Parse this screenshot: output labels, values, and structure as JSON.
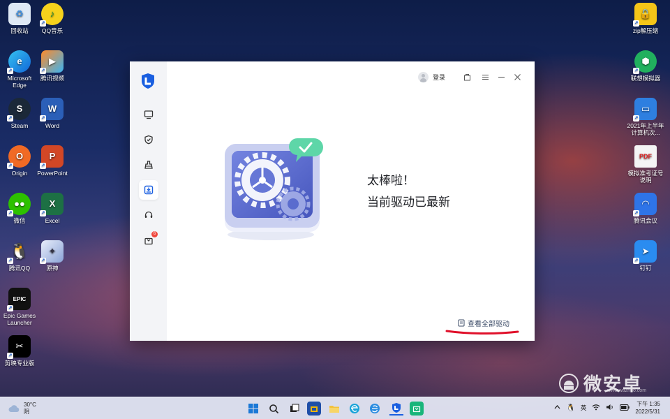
{
  "desktop_left": [
    {
      "label": "回收站",
      "icon": "recycle-bin-icon",
      "color": "#5aa7e8"
    },
    {
      "label": "QQ音乐",
      "icon": "qq-music-icon",
      "color": "#f6d21c"
    },
    {
      "label": "Microsoft Edge",
      "icon": "edge-icon",
      "color": "#1aa3d8"
    },
    {
      "label": "腾讯视频",
      "icon": "tencent-video-icon",
      "color": "#3bb4f2"
    },
    {
      "label": "Steam",
      "icon": "steam-icon",
      "color": "#1b2838"
    },
    {
      "label": "Word",
      "icon": "word-icon",
      "color": "#2b5fb8"
    },
    {
      "label": "Origin",
      "icon": "origin-icon",
      "color": "#f06a25"
    },
    {
      "label": "PowerPoint",
      "icon": "powerpoint-icon",
      "color": "#d24726"
    },
    {
      "label": "微信",
      "icon": "wechat-icon",
      "color": "#2dc100"
    },
    {
      "label": "Excel",
      "icon": "excel-icon",
      "color": "#1d7044"
    },
    {
      "label": "腾讯QQ",
      "icon": "qq-icon",
      "color": "#111111"
    },
    {
      "label": "原神",
      "icon": "genshin-icon",
      "color": "#c9d6ef"
    },
    {
      "label": "Epic Games Launcher",
      "icon": "epic-games-icon",
      "color": "#111111"
    },
    {
      "label": "剪映专业版",
      "icon": "capcut-icon",
      "color": "#000000"
    }
  ],
  "desktop_right": [
    {
      "label": "zip解压缩",
      "icon": "zip-icon",
      "color": "#f5c518"
    },
    {
      "label": "联想模拟器",
      "icon": "lenovo-emulator-icon",
      "color": "#21b05e"
    },
    {
      "label": "2021年上半年计算机次...",
      "icon": "screen-cast-icon",
      "color": "#2e7fe0"
    },
    {
      "label": "模拟准考证号说明",
      "icon": "pdf-icon",
      "color": "#e8e8e8"
    },
    {
      "label": "腾讯会议",
      "icon": "tencent-meeting-icon",
      "color": "#2e74e8"
    },
    {
      "label": "钉钉",
      "icon": "dingtalk-icon",
      "color": "#2a8cf0"
    }
  ],
  "app": {
    "login_label": "登录",
    "message_line1": "太棒啦！",
    "message_line2": "当前驱动已最新",
    "view_all_label": "查看全部驱动",
    "sidebar_items": [
      {
        "name": "sidebar-item-hardware",
        "icon": "monitor-icon"
      },
      {
        "name": "sidebar-item-security",
        "icon": "shield-icon"
      },
      {
        "name": "sidebar-item-cleanup",
        "icon": "broom-icon"
      },
      {
        "name": "sidebar-item-drivers",
        "icon": "driver-icon",
        "active": true
      },
      {
        "name": "sidebar-item-support",
        "icon": "headset-icon"
      },
      {
        "name": "sidebar-item-store",
        "icon": "bag-icon",
        "badge": "6"
      }
    ],
    "accent_color": "#1a5fe0"
  },
  "taskbar": {
    "temperature": "30°C",
    "weather": "阴",
    "language": "英",
    "time": "下午 1:35",
    "date": "2022/5/31"
  },
  "watermark": {
    "text": "微安卓",
    "url": "www.wazhuo.com"
  }
}
